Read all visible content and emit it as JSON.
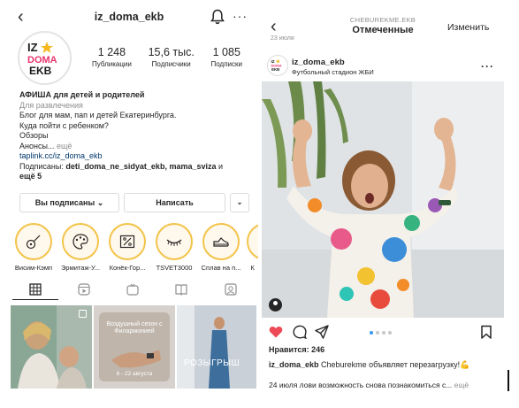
{
  "profile": {
    "username": "iz_doma_ekb",
    "stats": [
      {
        "num": "1 248",
        "label": "Публикации"
      },
      {
        "num": "15,6 тыс.",
        "label": "Подписчики"
      },
      {
        "num": "1 085",
        "label": "Подписки"
      }
    ],
    "bio": {
      "name": "АФИША для детей и родителей",
      "category": "Для развлечения",
      "line1": "Блог для мам, пап и детей Екатеринбурга.",
      "line2": "Куда пойти с ребенком?",
      "line3": "Обзоры",
      "line4": "Анонсы...",
      "line4_more": "ещё",
      "link": "taplink.cc/iz_doma_ekb",
      "subs_prefix": "Подписаны:",
      "subs_names": "deti_doma_ne_sidyat_ekb, mama_sviza",
      "subs_and": "и",
      "subs_more": "ещё 5"
    },
    "buttons": {
      "follow": "Вы подписаны",
      "message": "Написать"
    },
    "highlights": [
      {
        "caption": "Висим-Кэмп",
        "icon": "guitar-icon"
      },
      {
        "caption": "Эрмитаж-У...",
        "icon": "palette-icon"
      },
      {
        "caption": "Конёк-Гор...",
        "icon": "discount-icon"
      },
      {
        "caption": "TSVET3000",
        "icon": "eyelash-icon"
      },
      {
        "caption": "Сплав на п...",
        "icon": "sneaker-icon"
      },
      {
        "caption": "К",
        "icon": "partial-icon"
      }
    ],
    "grid": {
      "post2_text": "Воздушный сезон с Филармонией",
      "post2_date": "6 - 22 августа",
      "post3_text": "РОЗЫГРЫШ"
    }
  },
  "saved": {
    "owner": "CHEBUREKME.EKB",
    "title": "Отмеченные",
    "edit": "Изменить",
    "date_above": "23 июля",
    "post": {
      "username": "iz_doma_ekb",
      "location": "Футбольный стадион ЖБИ",
      "likes": "Нравится: 246",
      "caption_user": "iz_doma_ekb",
      "caption_text": "Cheburekme объявляет перезагрузку!",
      "caption_emoji": "💪",
      "comment_text": "24 июля лови возможность снова познакомиться с...",
      "comment_more": "ещё"
    },
    "carousel": {
      "total": 4,
      "active": 1
    }
  },
  "colors": {
    "text": "#262626",
    "muted": "#8e8e8e",
    "link": "#00376b",
    "like_red": "#ed4956",
    "accent_blue": "#3897f0",
    "highlight_ring": "#f3c44a"
  }
}
